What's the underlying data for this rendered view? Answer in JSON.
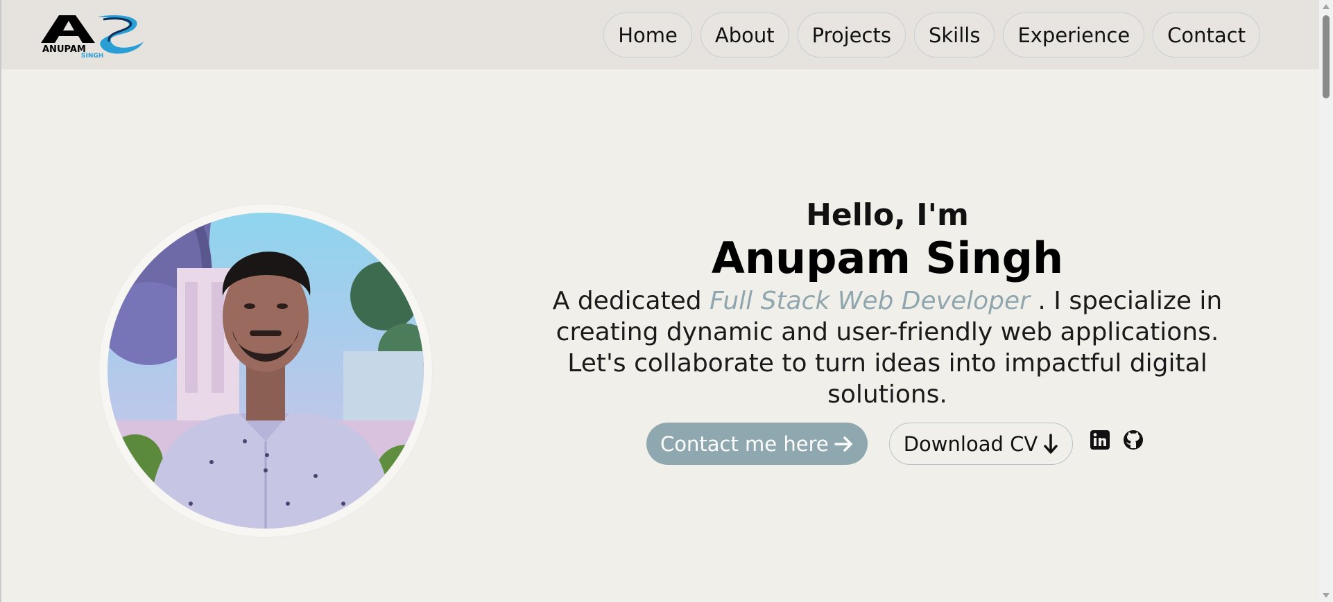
{
  "header": {
    "logo": {
      "main_letters": "AS",
      "line1": "ANUPAM",
      "line2": "SINGH"
    },
    "nav": [
      "Home",
      "About",
      "Projects",
      "Skills",
      "Experience",
      "Contact"
    ]
  },
  "hero": {
    "greeting": "Hello, I'm",
    "name": "Anupam Singh",
    "tagline_prefix": "A dedicated",
    "tagline_highlight": "Full Stack Web Developer",
    "tagline_suffix": ". I specialize in creating dynamic and user-friendly web applications. Let's collaborate to turn ideas into impactful digital solutions.",
    "contact_button": "Contact me here",
    "cv_button": "Download CV",
    "social_icons": [
      "linkedin-icon",
      "github-icon"
    ]
  },
  "colors": {
    "page_bg": "#f0efe9",
    "header_bg": "#e6e2dd",
    "accent": "#8fa8b0",
    "highlight_text": "#8fa6ae"
  }
}
